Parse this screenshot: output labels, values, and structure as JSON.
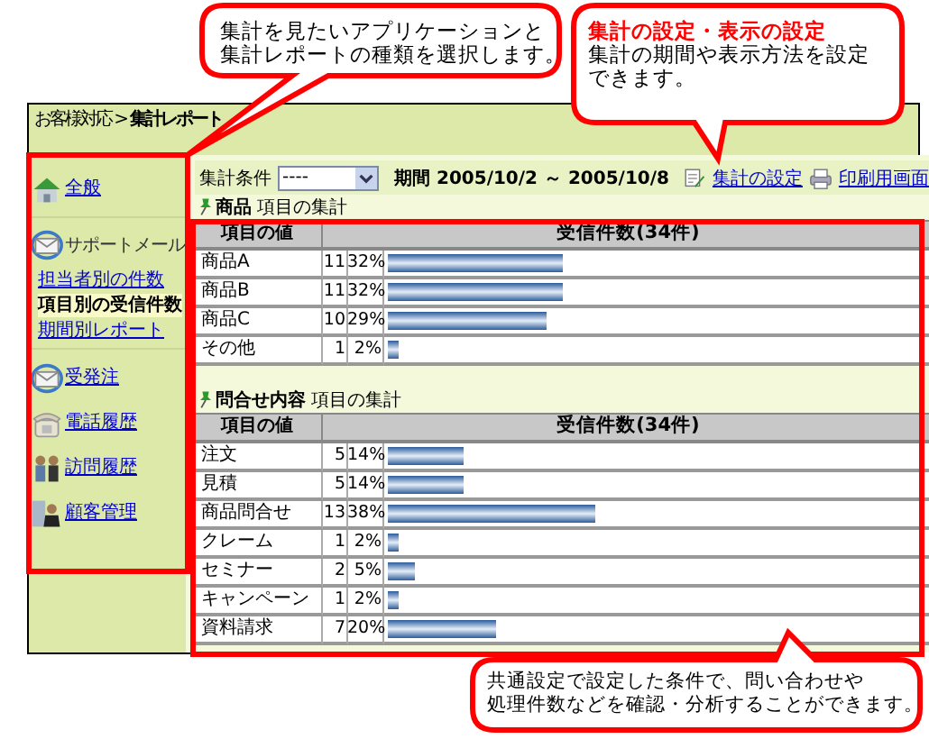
{
  "breadcrumb": "お客様対応 > **集計レポート**",
  "sidebar": {
    "sections": [
      {
        "items": [
          {
            "kind": "link",
            "label": "全般",
            "selected": false
          }
        ]
      },
      {
        "items": [
          {
            "kind": "group",
            "label": "サポートメール",
            "selected": false
          },
          {
            "kind": "sublink",
            "label": "担当者別の件数",
            "selected": false
          },
          {
            "kind": "sublink",
            "label": "項目別の受信件数",
            "selected": true
          },
          {
            "kind": "sublink",
            "label": "期間別レポート",
            "selected": false
          }
        ]
      },
      {
        "items": [
          {
            "kind": "link",
            "label": "受発注",
            "selected": false
          },
          {
            "kind": "link",
            "label": "電話履歴",
            "selected": false
          },
          {
            "kind": "link",
            "label": "訪問履歴",
            "selected": false
          },
          {
            "kind": "link",
            "label": "顧客管理",
            "selected": false
          }
        ]
      }
    ]
  },
  "toolbar": {
    "condition_label": "集計条件",
    "condition_value": "----",
    "period": "期間 2005/10/2 ～ 2005/10/8",
    "links": [
      {
        "label": "集計の設定"
      },
      {
        "label": "印刷用画面"
      }
    ]
  },
  "tables": [
    {
      "title": "**商品** 項目の集計",
      "columns": [
        "項目の値",
        "受信件数(34件)"
      ],
      "rows": [
        {
          "name": "商品A",
          "count": "11",
          "percent": "32%",
          "level": 0.32
        },
        {
          "name": "商品B",
          "count": "11",
          "percent": "32%",
          "level": 0.32
        },
        {
          "name": "商品C",
          "count": "10",
          "percent": "29%",
          "level": 0.29
        },
        {
          "name": "その他",
          "count": "1",
          "percent": "2%",
          "level": 0.02
        }
      ]
    },
    {
      "title": "**問合せ内容** 項目の集計",
      "columns": [
        "項目の値",
        "受信件数(34件)"
      ],
      "rows": [
        {
          "name": "注文",
          "count": "5",
          "percent": "14%",
          "level": 0.14
        },
        {
          "name": "見積",
          "count": "5",
          "percent": "14%",
          "level": 0.14
        },
        {
          "name": "商品問合せ",
          "count": "13",
          "percent": "38%",
          "level": 0.38
        },
        {
          "name": "クレーム",
          "count": "1",
          "percent": "2%",
          "level": 0.02
        },
        {
          "name": "セミナー",
          "count": "2",
          "percent": "5%",
          "level": 0.05
        },
        {
          "name": "キャンペーン",
          "count": "1",
          "percent": "2%",
          "level": 0.02
        },
        {
          "name": "資料請求",
          "count": "7",
          "percent": "20%",
          "level": 0.2
        }
      ]
    }
  ],
  "callouts": [
    {
      "lines": [
        "集計を見たいアプリケーションと",
        "集計レポートの種類を選択します。"
      ]
    },
    {
      "title": "集計の設定・表示の設定",
      "lines": [
        "集計の期間や表示方法を設定",
        "できます。"
      ]
    },
    {
      "lines": [
        "共通設定で設定した条件で、問い合わせや",
        "処理件数などを確認・分析することができます。"
      ]
    }
  ]
}
